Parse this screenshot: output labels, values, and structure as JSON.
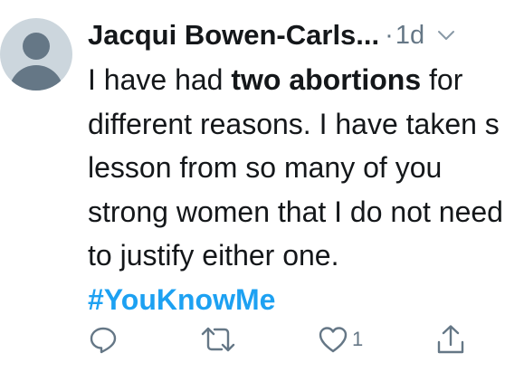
{
  "tweet": {
    "author_name": "Jacqui Bowen-Carls...",
    "separator": "·",
    "timestamp": "1d",
    "text_parts": {
      "p1": "I have had ",
      "p2": "two abortions",
      "p3": " for different reasons. I have taken s lesson from so many of you strong women that I do not need to justify either one. ",
      "hashtag": "#YouKnowMe"
    },
    "like_count": "1"
  },
  "icons": {
    "reply": "reply-icon",
    "retweet": "retweet-icon",
    "like": "heart-icon",
    "share": "share-icon",
    "menu": "chevron-down-icon"
  },
  "colors": {
    "text": "#14171a",
    "secondary": "#657786",
    "link": "#1da1f2",
    "avatar_bg": "#ccd6dd"
  }
}
